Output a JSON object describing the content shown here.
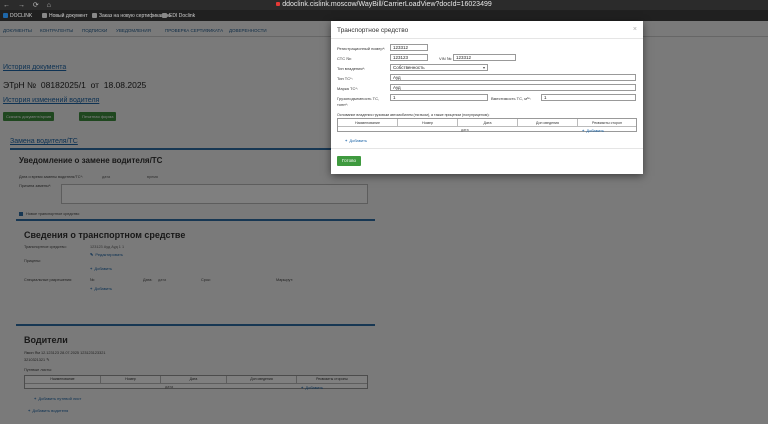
{
  "browser": {
    "url": "ddoclink.cislink.moscow/WayBill/CarrierLoadView?docId=16023499",
    "bookmarks": [
      "DOCLINK",
      "Новый документ",
      "Заказ на новую сертификацию",
      "EDI Doclink"
    ]
  },
  "nav": {
    "items": [
      "Документы",
      "Контрагенты",
      "Подписки",
      "Уведомления",
      "Проверка сертификата",
      "Доверенности"
    ]
  },
  "page": {
    "history_link": "История документа",
    "doc_prefix": "ЭТрН №",
    "doc_number": "08182025/1",
    "doc_from": "от",
    "doc_date": "18.08.2025",
    "driver_history_link": "История изменений водителя",
    "btn_download": "Скачать документ/архив",
    "btn_print": "Печатная форма",
    "vehicle_link": "Замена водителя/ТС",
    "notice_title": "Уведомление о замене водителя/ТС",
    "date_label": "Дата и время замены водителя/ТС*:",
    "date_value": "дата",
    "time_value": "время",
    "reason_label": "Причина замены*:",
    "checkbox_label": "Новое транспортное средство",
    "vehicle_section_title": "Сведения о транспортном средстве",
    "vehicle_label": "Транспортное средство:",
    "vehicle_value": "123123 Ауд Ауд 1 1",
    "edit_link": "Редактировать",
    "trailers_label": "Прицепы:",
    "add_label": "Добавить",
    "permits_label": "Специальные разрешения:",
    "permit_no": "№:",
    "permit_date": "Дата:",
    "permit_date_val": "дата",
    "permit_term": "Срок:",
    "permit_route": "Маршрут:",
    "drivers_title": "Водители",
    "driver_line1": "Ямин Ям 12.123123 28.07.2025 123123123321",
    "driver_line2": "3210321321",
    "waybills_label": "Путевые листы:",
    "waybill_table": {
      "headers": [
        "Наименование",
        "Номер",
        "Дата",
        "Доп сведения",
        "Реквизиты стороны"
      ],
      "date_placeholder": "дата",
      "add_label": "Добавить"
    },
    "add_waybill": "Добавить путевой лист",
    "add_driver": "Добавить водителя"
  },
  "modal": {
    "title": "Транспортное средство",
    "close": "×",
    "reg_label": "Регистрационный номер*:",
    "reg_value": "123312",
    "sts_label": "СТС №:",
    "sts_value": "123123",
    "vin_label": "VIN №:",
    "vin_value": "123312",
    "ownership_label": "Тип владения*:",
    "ownership_value": "Собственность",
    "type_label": "Тип ТС*:",
    "type_value": "Ауд",
    "brand_label": "Марка ТС*:",
    "brand_value": "Ауд",
    "capacity_label_1": "Грузоподъемность ТС,",
    "capacity_label_2": "тонн*:",
    "capacity_value": "1",
    "volume_label": "Вместимость ТС, м³*:",
    "volume_value": "1",
    "basis_label": "Основание владения грузовым автомобилем (тягачом), а также прицепом (полуприцепом):",
    "table": {
      "headers": [
        "Наименование",
        "Номер",
        "Дата",
        "Доп сведения",
        "Реквизиты сторон"
      ],
      "date_placeholder": "дата",
      "row_add": "Добавить"
    },
    "add_link": "Добавить",
    "ok_button": "Готово"
  }
}
